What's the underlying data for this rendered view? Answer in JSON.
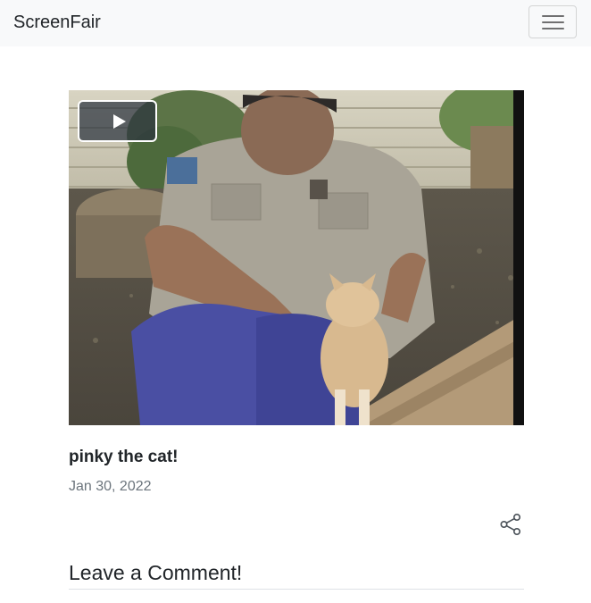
{
  "navbar": {
    "brand": "ScreenFair",
    "menu_icon": "hamburger-menu-icon"
  },
  "video": {
    "play_icon": "play-icon",
    "thumbnail_description": "man in uniform petting a cat"
  },
  "post": {
    "title": "pinky the cat!",
    "date": "Jan 30, 2022",
    "share_icon": "share-icon"
  },
  "comments": {
    "heading": "Leave a Comment!"
  },
  "colors": {
    "navbar_bg": "#f8f9fa",
    "muted_text": "#6c757d",
    "body_text": "#212529",
    "divider": "#dee2e6"
  }
}
